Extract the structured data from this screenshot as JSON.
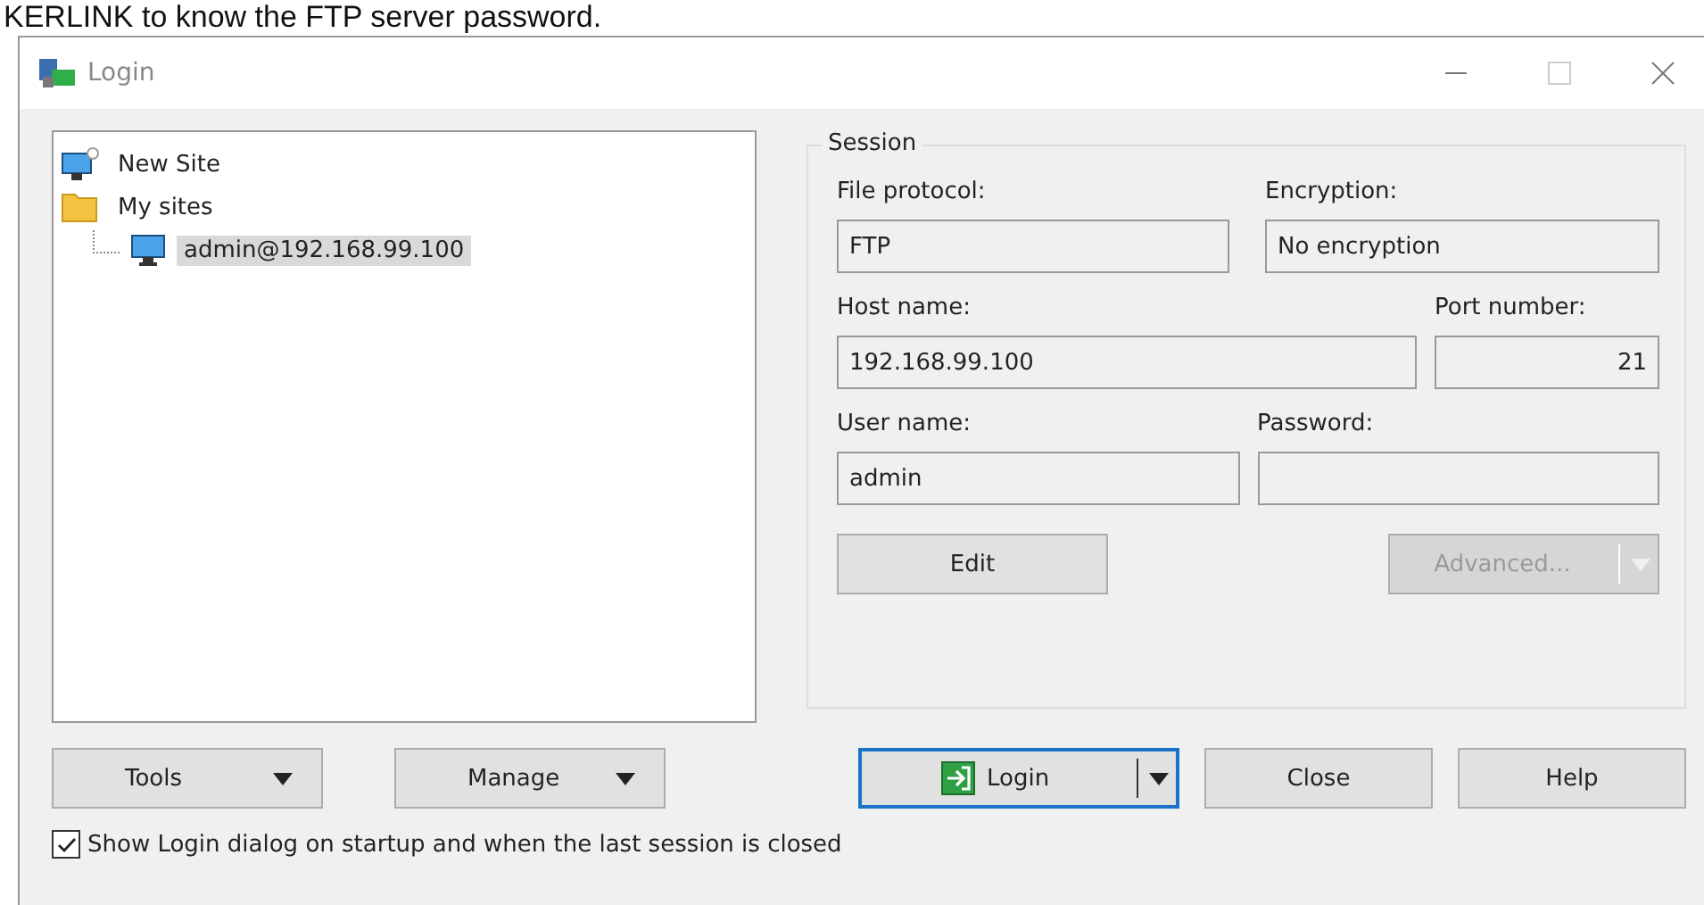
{
  "caption": "KERLINK to know the FTP server password.",
  "window": {
    "title": "Login"
  },
  "tree": [
    {
      "label": "New Site",
      "kind": "new-site",
      "selected": false
    },
    {
      "label": "My sites",
      "kind": "folder",
      "selected": false,
      "children": [
        {
          "label": "admin@192.168.99.100",
          "kind": "site",
          "selected": true
        }
      ]
    }
  ],
  "session": {
    "title": "Session",
    "rows": [
      [
        {
          "label": "File protocol:",
          "value": "FTP",
          "kind": "text"
        },
        {
          "label": "Encryption:",
          "value": "No encryption",
          "kind": "text"
        }
      ],
      [
        {
          "label": "Host name:",
          "value": "192.168.99.100",
          "kind": "text"
        },
        {
          "label": "Port number:",
          "value": "21",
          "kind": "number"
        }
      ],
      [
        {
          "label": "User name:",
          "value": "admin",
          "kind": "text"
        },
        {
          "label": "Password:",
          "kind": "password"
        }
      ]
    ],
    "buttons": [
      {
        "label": "Edit",
        "disabled": false,
        "split": false
      },
      {
        "label": "Advanced...",
        "disabled": true,
        "split": true
      }
    ]
  },
  "tool_buttons": [
    {
      "label": "Tools"
    },
    {
      "label": "Manage"
    }
  ],
  "action_buttons": [
    {
      "label": "Login",
      "default": true,
      "split": true,
      "icon": true
    },
    {
      "label": "Close",
      "default": false,
      "split": false,
      "icon": false
    },
    {
      "label": "Help",
      "default": false,
      "split": false,
      "icon": false
    }
  ],
  "startup_checkbox": {
    "label": "Show Login dialog on startup and when the last session is closed",
    "checked": true
  }
}
